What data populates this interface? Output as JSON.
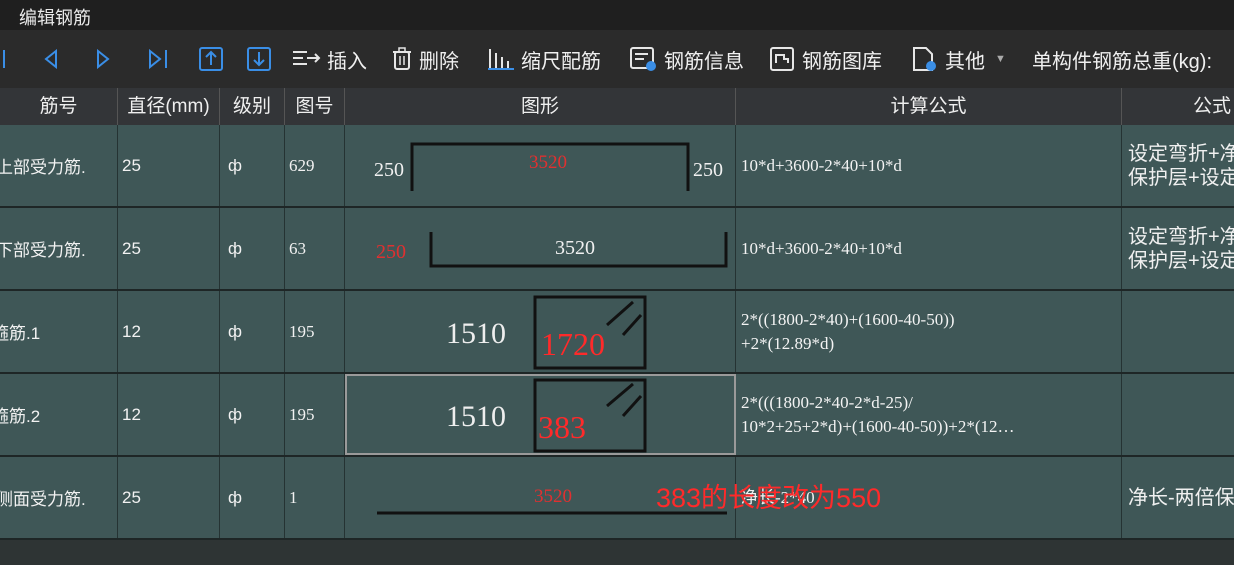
{
  "window": {
    "title": "编辑钢筋"
  },
  "toolbar": {
    "insert_label": "插入",
    "delete_label": "删除",
    "scale_label": "缩尺配筋",
    "info_label": "钢筋信息",
    "library_label": "钢筋图库",
    "other_label": "其他",
    "weight_label": "单构件钢筋总重(kg):"
  },
  "columns": {
    "name": "筋号",
    "diameter": "直径(mm)",
    "grade": "级别",
    "figure_no": "图号",
    "shape": "图形",
    "formula": "计算公式",
    "desc": "公式"
  },
  "rows": [
    {
      "name": "上部受力筋.",
      "diameter": "25",
      "grade": "ф",
      "figure_no": "629",
      "shape": {
        "left": "250",
        "mid": "3520",
        "right": "250"
      },
      "formula": [
        "10*d+3600-2*40+10*d"
      ],
      "desc": [
        "设定弯折+净",
        "保护层+设定"
      ]
    },
    {
      "name": "下部受力筋.",
      "diameter": "25",
      "grade": "ф",
      "figure_no": "63",
      "shape": {
        "left": "250",
        "mid": "3520"
      },
      "formula": [
        "10*d+3600-2*40+10*d"
      ],
      "desc": [
        "设定弯折+净",
        "保护层+设定"
      ]
    },
    {
      "name": "箍筋.1",
      "diameter": "12",
      "grade": "ф",
      "figure_no": "195",
      "shape": {
        "w": "1510",
        "h": "1720"
      },
      "formula": [
        "2*((1800-2*40)+(1600-40-50))",
        "+2*(12.89*d)"
      ],
      "desc": []
    },
    {
      "name": "箍筋.2",
      "diameter": "12",
      "grade": "ф",
      "figure_no": "195",
      "shape": {
        "w": "1510",
        "h": "383"
      },
      "formula": [
        "2*(((1800-2*40-2*d-25)/",
        "10*2+25+2*d)+(1600-40-50))+2*(12…"
      ],
      "desc": []
    },
    {
      "name": "侧面受力筋.",
      "diameter": "25",
      "grade": "ф",
      "figure_no": "1",
      "shape": {
        "mid": "3520"
      },
      "formula": [
        "净长-2*40"
      ],
      "desc": [
        "净长-两倍保"
      ]
    }
  ],
  "annotation": "383的长度改为550",
  "colors": {
    "row_bg": "#3f5757",
    "accent_blue": "#3a8ee6",
    "dim_red": "#e03030"
  }
}
